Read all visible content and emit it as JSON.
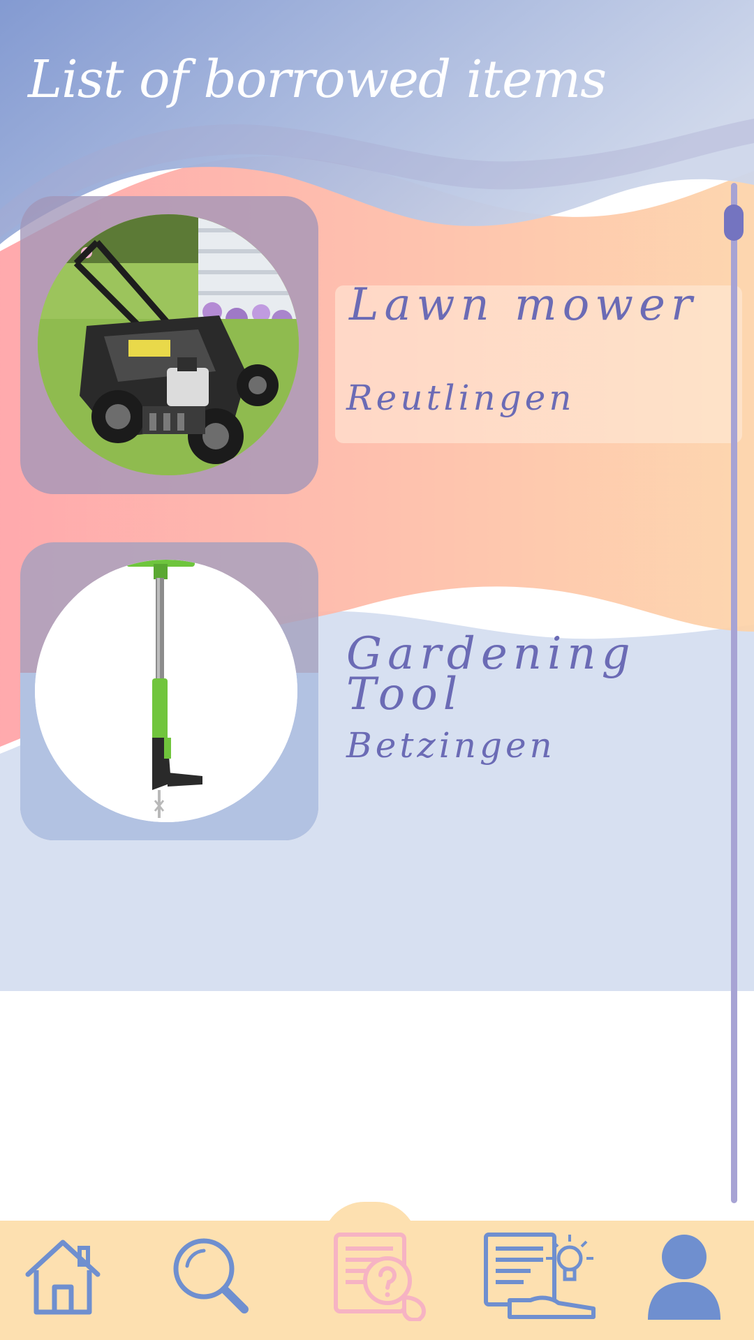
{
  "header": {
    "title": "List of borrowed items"
  },
  "items": [
    {
      "name": "Lawn mower",
      "location": "Reutlingen",
      "image_icon": "lawn-mower-photo"
    },
    {
      "name": "Gardening Tool",
      "location": "Betzingen",
      "image_icon": "weeder-tool-photo"
    }
  ],
  "nav": {
    "items": [
      {
        "icon": "home-icon",
        "active": false
      },
      {
        "icon": "search-icon",
        "active": false
      },
      {
        "icon": "help-request-icon",
        "active": true
      },
      {
        "icon": "offer-idea-icon",
        "active": false
      },
      {
        "icon": "profile-icon",
        "active": false
      }
    ]
  },
  "colors": {
    "accent": "#6b6bb5",
    "nav_icon": "#6f8fcf",
    "nav_active": "#f6b3c3",
    "nav_background": "#fde0b0",
    "scrollbar": "#a7a3d4"
  }
}
